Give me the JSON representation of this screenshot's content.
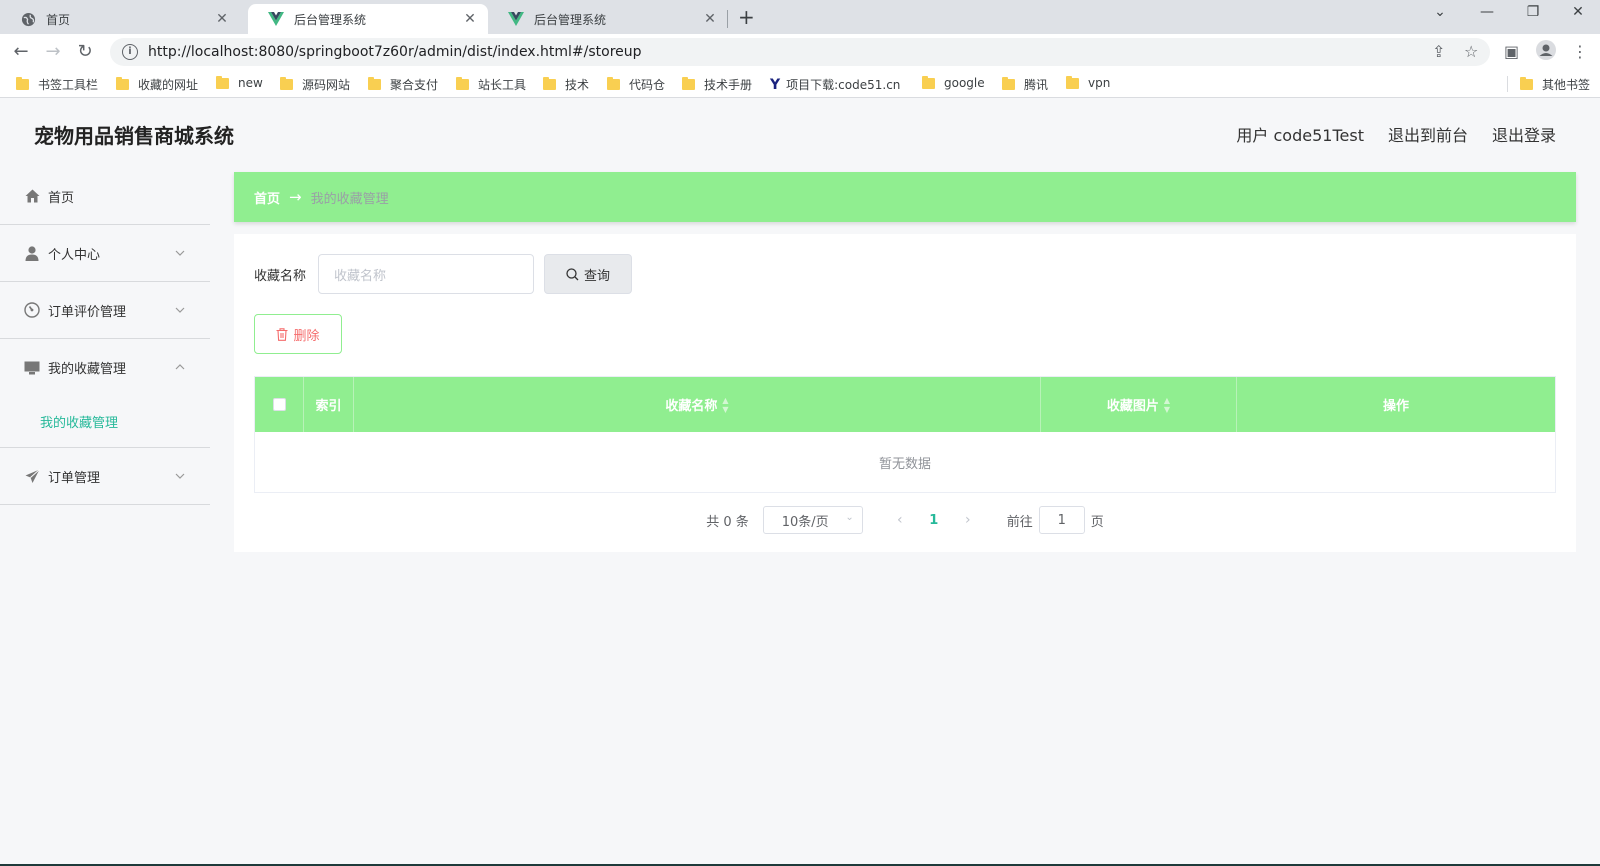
{
  "browser": {
    "tabs": [
      {
        "label": "首页",
        "icon": "globe-icon"
      },
      {
        "label": "后台管理系统",
        "icon": "vue-icon",
        "active": true
      },
      {
        "label": "后台管理系统",
        "icon": "vue-icon"
      }
    ],
    "url": "http://localhost:8080/springboot7z60r/admin/dist/index.html#/storeup",
    "bookmarks": [
      "书签工具栏",
      "收藏的网址",
      "new",
      "源码网站",
      "聚合支付",
      "站长工具",
      "技术",
      "代码仓",
      "技术手册",
      "项目下载:code51.cn",
      "google",
      "腾讯",
      "vpn"
    ],
    "other_bookmarks": "其他书签"
  },
  "app": {
    "title": "宠物用品销售商城系统",
    "header_links": [
      "用户 code51Test",
      "退出到前台",
      "退出登录"
    ]
  },
  "sidebar": {
    "items": [
      {
        "label": "首页",
        "icon": "home-icon"
      },
      {
        "label": "个人中心",
        "icon": "user-icon",
        "expandable": true
      },
      {
        "label": "订单评价管理",
        "icon": "gauge-icon",
        "expandable": true
      },
      {
        "label": "我的收藏管理",
        "icon": "monitor-icon",
        "expandable": true,
        "expanded": true
      },
      {
        "label": "订单管理",
        "icon": "send-icon",
        "expandable": true
      }
    ],
    "submenu_label": "我的收藏管理"
  },
  "breadcrumb": {
    "home": "首页",
    "arrow": "→",
    "current": "我的收藏管理"
  },
  "search": {
    "label": "收藏名称",
    "placeholder": "收藏名称",
    "button": "查询"
  },
  "delete_button": "删除",
  "table": {
    "columns": [
      "索引",
      "收藏名称",
      "收藏图片",
      "操作"
    ],
    "empty_text": "暂无数据"
  },
  "pagination": {
    "total": "共 0 条",
    "page_size": "10条/页",
    "current_page": "1",
    "goto_label": "前往",
    "goto_value": "1",
    "page_suffix": "页"
  },
  "colors": {
    "accent": "#90ee90",
    "teal": "#26b99a",
    "danger": "#f56c6c"
  }
}
